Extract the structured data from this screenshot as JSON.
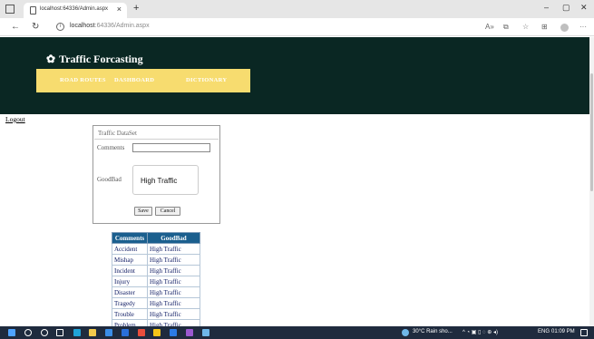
{
  "browser": {
    "tab_title": "localhost:64336/Admin.aspx",
    "tab_close": "×",
    "new_tab": "+",
    "url_host": "localhost",
    "url_rest": ":64336/Admin.aspx",
    "window_controls": {
      "minimize": "–",
      "maximize": "▢",
      "close": "✕"
    },
    "icons": [
      "window-menu-icon",
      "page-icon",
      "back-icon",
      "refresh-icon",
      "info-icon",
      "read-aloud-icon",
      "extensions-icon",
      "favorites-icon",
      "collections-icon",
      "profile-icon",
      "more-icon"
    ]
  },
  "header": {
    "brand_icon": "✿",
    "brand": "Traffic Forcasting",
    "bg_color": "#0a2723",
    "menu_color": "#f7dc6f",
    "menu": [
      "ROAD ROUTES",
      "DASHBOARD",
      "DICTIONARY"
    ]
  },
  "logout": "Logout",
  "form": {
    "title": "Traffic DataSet",
    "comments_label": "Comments",
    "comments_value": "",
    "goodbad_label": "GoodBad",
    "goodbad_value": "High Traffic",
    "save": "Save",
    "cancel": "Cancel"
  },
  "grid": {
    "headers": [
      "Comments",
      "GoodBad"
    ],
    "rows": [
      [
        "Accident",
        "High Traffic"
      ],
      [
        "Mishap",
        "High Traffic"
      ],
      [
        "Incident",
        "High Traffic"
      ],
      [
        "Injury",
        "High Traffic"
      ],
      [
        "Disaster",
        "High Traffic"
      ],
      [
        "Tragedy",
        "High Traffic"
      ],
      [
        "Trouble",
        "High Traffic"
      ],
      [
        "Problem",
        "High Traffic"
      ]
    ]
  },
  "taskbar": {
    "weather": "30°C  Rain sho...",
    "language": "ENG",
    "time": "01:09 PM"
  }
}
